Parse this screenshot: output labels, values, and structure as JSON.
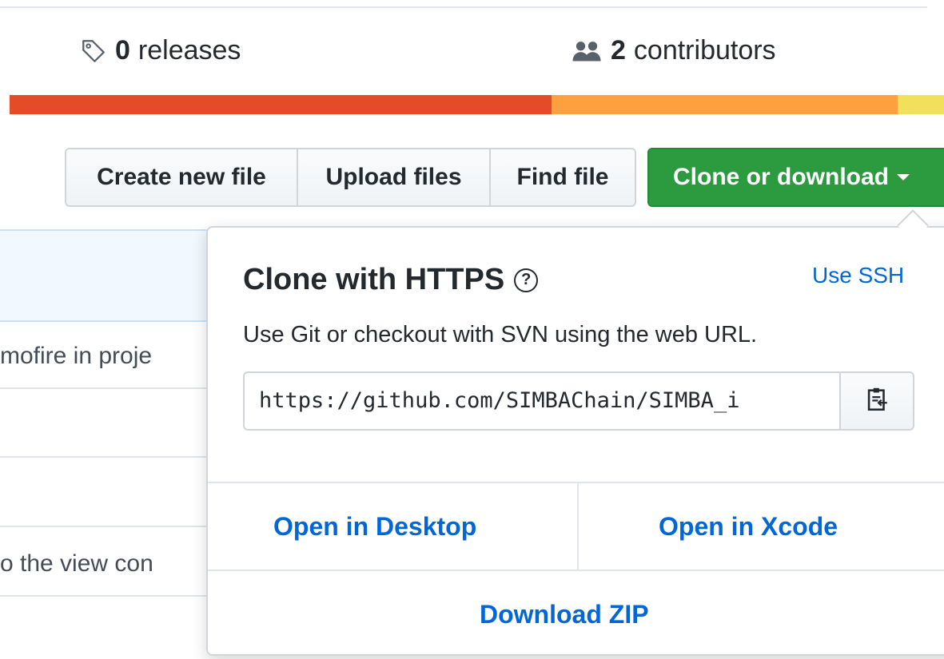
{
  "stats": {
    "releases": {
      "count": "0",
      "label": "releases",
      "icon": "tag-icon"
    },
    "contributors": {
      "count": "2",
      "label": "contributors",
      "icon": "people-icon"
    }
  },
  "language_bar": {
    "segments": [
      {
        "color": "#e34c26",
        "share": 0.58
      },
      {
        "color": "#ffa03e",
        "share": 0.37
      },
      {
        "color": "#f1e05a",
        "share": 0.05
      }
    ]
  },
  "toolbar": {
    "create_label": "Create new file",
    "upload_label": "Upload files",
    "find_label": "Find file",
    "clone_label": "Clone or download"
  },
  "background_rows": {
    "row1_text": "mofire in proje",
    "row4_text": "o the view con"
  },
  "clone_panel": {
    "title": "Clone with HTTPS",
    "help_glyph": "?",
    "use_ssh": "Use SSH",
    "description": "Use Git or checkout with SVN using the web URL.",
    "url": "https://github.com/SIMBAChain/SIMBA_i",
    "copy_icon": "clipboard-icon",
    "open_desktop": "Open in Desktop",
    "open_xcode": "Open in Xcode",
    "download_zip": "Download ZIP"
  },
  "colors": {
    "accent_link": "#0366d6",
    "clone_green": "#2c9b3f"
  }
}
